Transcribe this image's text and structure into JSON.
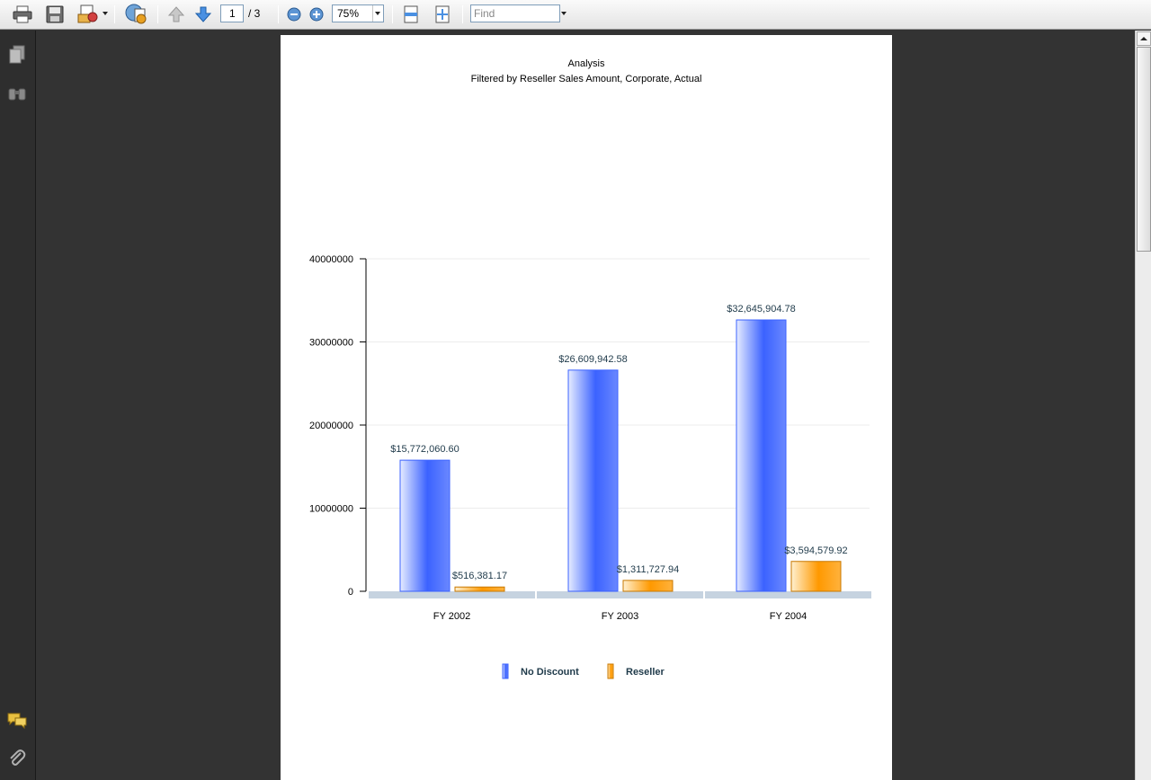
{
  "toolbar": {
    "page_current": "1",
    "page_total": "/ 3",
    "zoom": "75%",
    "find_placeholder": "Find"
  },
  "report": {
    "title": "Analysis",
    "subtitle": "Filtered by Reseller Sales Amount, Corporate, Actual"
  },
  "colors": {
    "no_discount": "#3b62ff",
    "reseller": "#ff9900",
    "label_text": "#1f3a4a"
  },
  "chart_data": {
    "type": "bar",
    "categories": [
      "FY 2002",
      "FY 2003",
      "FY 2004"
    ],
    "series": [
      {
        "name": "No Discount",
        "values": [
          15772060.6,
          26609942.58,
          32645904.78
        ],
        "labels": [
          "$15,772,060.60",
          "$26,609,942.58",
          "$32,645,904.78"
        ]
      },
      {
        "name": "Reseller",
        "values": [
          516381.17,
          1311727.94,
          3594579.92
        ],
        "labels": [
          "$516,381.17",
          "$1,311,727.94",
          "$3,594,579.92"
        ]
      }
    ],
    "yticks": [
      "0",
      "10000000",
      "20000000",
      "30000000",
      "40000000"
    ],
    "ylim": [
      0,
      40000000
    ],
    "grid": true,
    "legend_position": "bottom"
  }
}
